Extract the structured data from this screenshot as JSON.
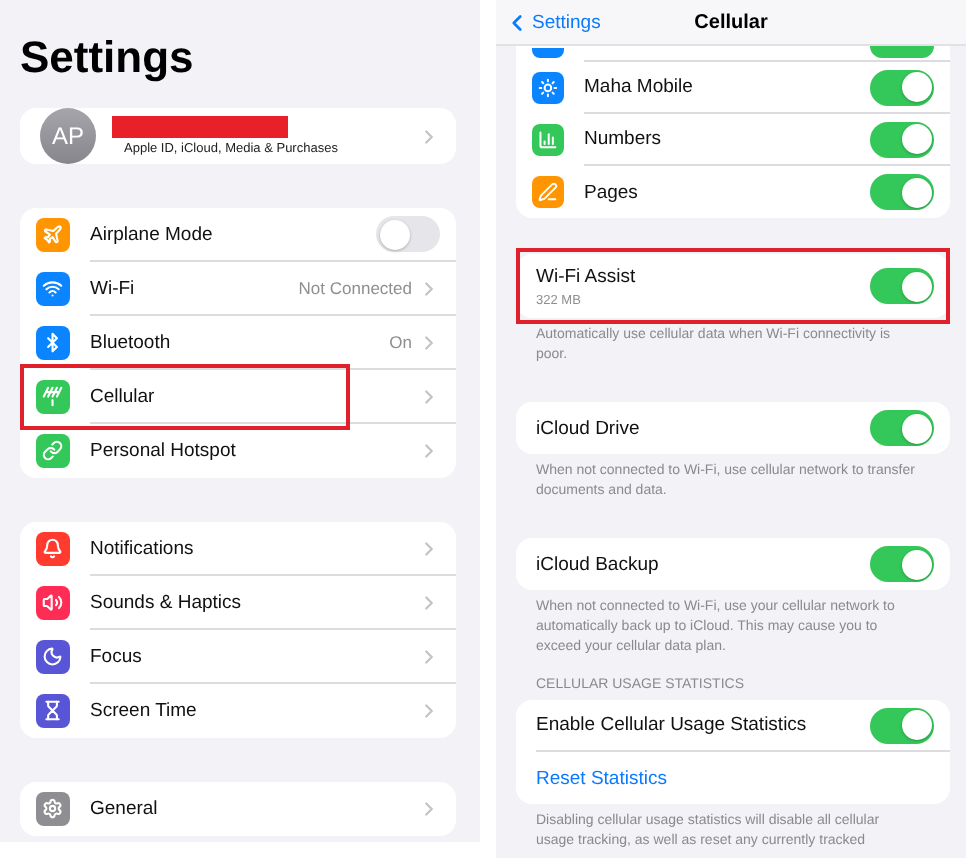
{
  "settings": {
    "title": "Settings",
    "profile": {
      "initials": "AP",
      "name_redacted": true,
      "subtitle": "Apple ID, iCloud, Media & Purchases"
    },
    "groups": [
      {
        "items": [
          {
            "kind": "toggle",
            "color": "#ff9500",
            "label": "Airplane Mode",
            "on": false,
            "highlighted": false
          },
          {
            "kind": "link",
            "color": "#0a84ff",
            "label": "Wi-Fi",
            "value": "Not Connected",
            "highlighted": false
          },
          {
            "kind": "link",
            "color": "#0a84ff",
            "label": "Bluetooth",
            "value": "On",
            "highlighted": false
          },
          {
            "kind": "link",
            "color": "#34c759",
            "label": "Cellular",
            "highlighted": true
          },
          {
            "kind": "link",
            "color": "#34c759",
            "label": "Personal Hotspot",
            "highlighted": false
          }
        ]
      },
      {
        "items": [
          {
            "kind": "link",
            "color": "#ff3b30",
            "label": "Notifications",
            "highlighted": false
          },
          {
            "kind": "link",
            "color": "#ff2d55",
            "label": "Sounds & Haptics",
            "highlighted": false
          },
          {
            "kind": "link",
            "color": "#5856d6",
            "label": "Focus",
            "highlighted": false
          },
          {
            "kind": "link",
            "color": "#5856d6",
            "label": "Screen Time",
            "highlighted": false
          }
        ]
      },
      {
        "items": [
          {
            "kind": "link",
            "color": "#8e8e93",
            "label": "General",
            "highlighted": false
          }
        ]
      }
    ]
  },
  "cellular": {
    "back": "Settings",
    "title": "Cellular",
    "apps": [
      {
        "kind": "partial",
        "color": "#0a84ff",
        "on": true
      },
      {
        "kind": "app",
        "color": "#0a84ff",
        "label": "Maha Mobile",
        "on": true
      },
      {
        "kind": "app",
        "color": "#34c759",
        "label": "Numbers",
        "on": true
      },
      {
        "kind": "app",
        "color": "#ff9500",
        "label": "Pages",
        "on": true
      }
    ],
    "sections": [
      {
        "rows": [
          {
            "kind": "toggle",
            "label": "Wi-Fi Assist",
            "detail": "322 MB",
            "on": true,
            "highlighted": true
          }
        ],
        "footer": "Automatically use cellular data when Wi-Fi connectivity is poor."
      },
      {
        "rows": [
          {
            "kind": "toggle",
            "label": "iCloud Drive",
            "on": true,
            "highlighted": false
          }
        ],
        "footer": "When not connected to Wi-Fi, use cellular network to transfer documents and data."
      },
      {
        "rows": [
          {
            "kind": "toggle",
            "label": "iCloud Backup",
            "on": true,
            "highlighted": false
          }
        ],
        "footer": "When not connected to Wi-Fi, use your cellular network to automatically back up to iCloud. This may cause you to exceed your cellular data plan."
      },
      {
        "header": "CELLULAR USAGE STATISTICS",
        "rows": [
          {
            "kind": "toggle",
            "label": "Enable Cellular Usage Statistics",
            "on": true,
            "highlighted": false
          },
          {
            "kind": "action",
            "label": "Reset Statistics",
            "highlighted": false
          }
        ],
        "footer": "Disabling cellular usage statistics will disable all cellular usage tracking, as well as reset any currently tracked"
      }
    ]
  }
}
